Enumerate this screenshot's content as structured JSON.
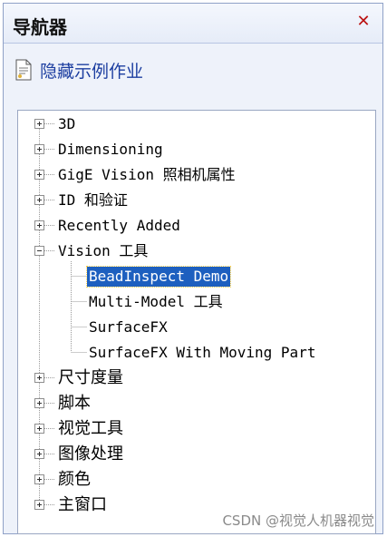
{
  "header": {
    "title": "导航器",
    "close_glyph": "✕"
  },
  "task": {
    "icon": "document-icon",
    "label": "隐藏示例作业"
  },
  "tree": {
    "top_items": [
      {
        "label": "3D",
        "expander": "plus"
      },
      {
        "label": "Dimensioning",
        "expander": "plus"
      },
      {
        "label": "GigE Vision 照相机属性",
        "expander": "plus"
      },
      {
        "label": "ID 和验证",
        "expander": "plus"
      },
      {
        "label": "Recently Added",
        "expander": "plus"
      },
      {
        "label": "Vision 工具",
        "expander": "minus"
      },
      {
        "label": "尺寸度量",
        "expander": "plus"
      },
      {
        "label": "脚本",
        "expander": "plus"
      },
      {
        "label": "视觉工具",
        "expander": "plus"
      },
      {
        "label": "图像处理",
        "expander": "plus"
      },
      {
        "label": "颜色",
        "expander": "plus"
      },
      {
        "label": "主窗口",
        "expander": "plus"
      }
    ],
    "vision_children": [
      {
        "label": "BeadInspect Demo",
        "selected": true
      },
      {
        "label": "Multi-Model 工具",
        "selected": false
      },
      {
        "label": "SurfaceFX",
        "selected": false
      },
      {
        "label": "SurfaceFX With Moving Part",
        "selected": false
      }
    ],
    "selection_color": "#1d5fbf"
  },
  "watermark": "CSDN @视觉人机器视觉"
}
